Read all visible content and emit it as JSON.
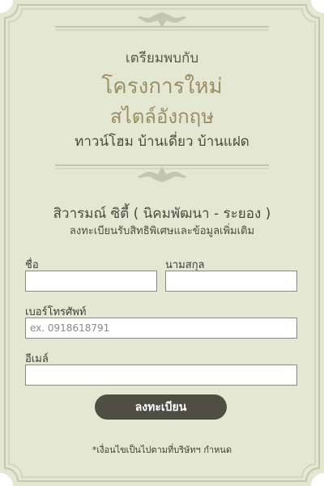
{
  "colors": {
    "background": "#e4e8d2",
    "frame": "#c3c6b0",
    "gold": "#9a8e67",
    "button": "#4f4e45"
  },
  "header": {
    "intro": "เตรียมพบกับ",
    "title_line1": "โครงการใหม่",
    "title_line2": "สไตล์อังกฤษ",
    "title_line3": "ทาวน์โฮม บ้านเดี่ยว บ้านแฝด"
  },
  "project": {
    "name": "สิวารมณ์ ซิตี้ ( นิคมพัฒนา - ระยอง )",
    "subtitle": "ลงทะเบียนรับสิทธิพิเศษและข้อมูลเพิ่มเติม"
  },
  "form": {
    "first_name_label": "ชื่อ",
    "first_name_value": "",
    "last_name_label": "นามสกุล",
    "last_name_value": "",
    "phone_label": "เบอร์โทรศัพท์",
    "phone_placeholder": "ex. 0918618791",
    "email_label": "อีเมล์",
    "email_value": "",
    "submit_label": "ลงทะเบียน"
  },
  "footer": {
    "note": "*เงื่อนไขเป็นไปตามที่บริษัทฯ กำหนด"
  },
  "icons": [
    "ornament-top-icon",
    "ornament-bottom-icon"
  ]
}
